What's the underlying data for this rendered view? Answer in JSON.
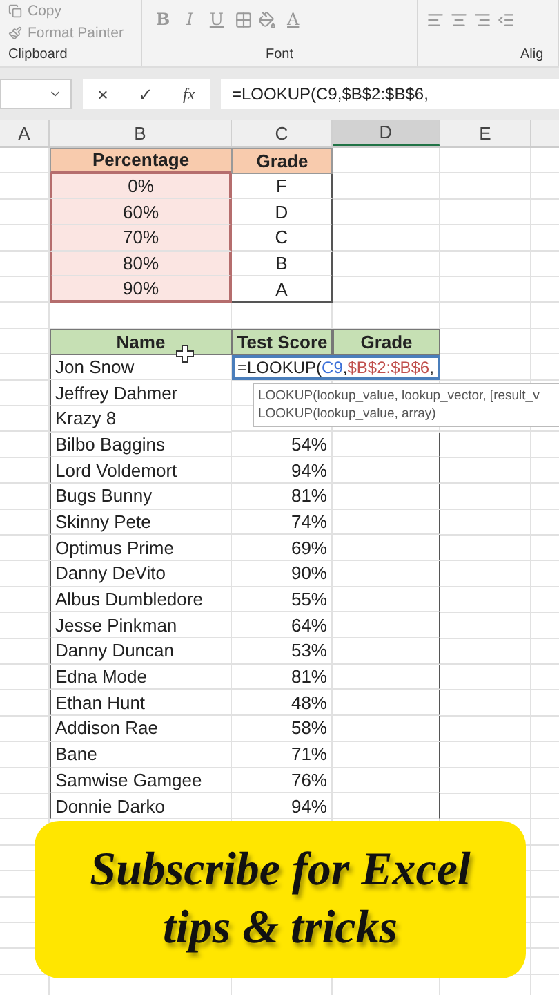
{
  "ribbon": {
    "clipboard": {
      "copy": "Copy",
      "format_painter": "Format Painter",
      "label": "Clipboard"
    },
    "font": {
      "bold": "B",
      "italic": "I",
      "underline": "U",
      "font_color": "A",
      "label": "Font"
    },
    "alignment": {
      "label": "Alig"
    }
  },
  "formula_bar": {
    "cancel": "×",
    "enter": "✓",
    "fx": "fx",
    "formula": "=LOOKUP(C9,$B$2:$B$6,"
  },
  "column_headers": [
    {
      "label": "A",
      "selected": false
    },
    {
      "label": "B",
      "selected": false
    },
    {
      "label": "C",
      "selected": false
    },
    {
      "label": "D",
      "selected": true
    },
    {
      "label": "E",
      "selected": false
    }
  ],
  "grade_table": {
    "columns": [
      "Percentage",
      "Grade"
    ],
    "rows": [
      [
        "0%",
        "F"
      ],
      [
        "60%",
        "D"
      ],
      [
        "70%",
        "C"
      ],
      [
        "80%",
        "B"
      ],
      [
        "90%",
        "A"
      ]
    ]
  },
  "score_table": {
    "columns": [
      "Name",
      "Test Score",
      "Grade"
    ],
    "rows": [
      {
        "name": "Jon Snow"
      },
      {
        "name": "Jeffrey Dahmer"
      },
      {
        "name": "Krazy 8"
      },
      {
        "name": "Bilbo Baggins",
        "score": "54%"
      },
      {
        "name": "Lord Voldemort",
        "score": "94%"
      },
      {
        "name": "Bugs Bunny",
        "score": "81%"
      },
      {
        "name": "Skinny Pete",
        "score": "74%"
      },
      {
        "name": "Optimus Prime",
        "score": "69%"
      },
      {
        "name": "Danny DeVito",
        "score": "90%"
      },
      {
        "name": "Albus Dumbledore",
        "score": "55%"
      },
      {
        "name": "Jesse Pinkman",
        "score": "64%"
      },
      {
        "name": "Danny Duncan",
        "score": "53%"
      },
      {
        "name": "Edna Mode",
        "score": "81%"
      },
      {
        "name": "Ethan Hunt",
        "score": "48%"
      },
      {
        "name": "Addison Rae",
        "score": "58%"
      },
      {
        "name": "Bane",
        "score": "71%"
      },
      {
        "name": "Samwise Gamgee",
        "score": "76%"
      },
      {
        "name": "Donnie Darko",
        "score": "94%"
      }
    ]
  },
  "active_cell": {
    "segments": [
      {
        "text": "=LOOKUP(",
        "color": "#222222"
      },
      {
        "text": "C9",
        "color": "#3a6fd8"
      },
      {
        "text": ",",
        "color": "#222222"
      },
      {
        "text": "$B$2:$B$6",
        "color": "#c0504d"
      },
      {
        "text": ",",
        "color": "#222222"
      }
    ]
  },
  "tooltip": {
    "lines": [
      "LOOKUP(lookup_value, lookup_vector, [result_v",
      "LOOKUP(lookup_value, array)"
    ]
  },
  "banner": {
    "lines": [
      "Subscribe for Excel",
      "tips & tricks"
    ]
  }
}
